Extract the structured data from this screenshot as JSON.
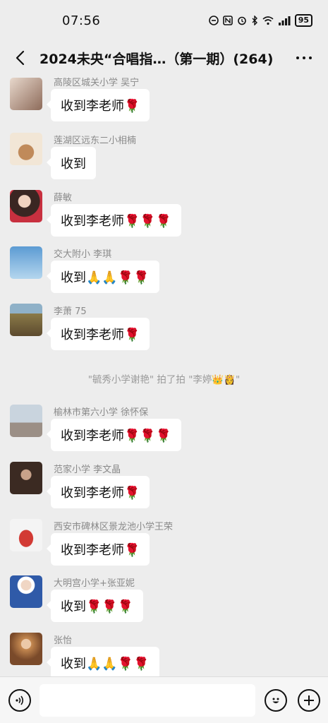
{
  "status_bar": {
    "time": "07:56",
    "battery": "95",
    "icons": [
      "nfc-icon",
      "mute-icon",
      "alarm-icon",
      "bluetooth-icon",
      "wifi-icon",
      "signal-icon",
      "battery-icon"
    ]
  },
  "header": {
    "title": "2024未央“合唱指…（第一期）(264)"
  },
  "messages": [
    {
      "sender": "高陵区城关小学  吴宁",
      "text": "收到李老师🌹",
      "avatar_color": "#c9b6a8"
    },
    {
      "sender": "莲湖区远东二小相楠",
      "text": "收到",
      "avatar_color": "#e9d9c3"
    },
    {
      "sender": "薛敏",
      "text": "收到李老师🌹🌹🌹",
      "avatar_color": "#b3475a"
    },
    {
      "sender": "交大附小  李琪",
      "text": "收到🙏🙏🌹🌹",
      "avatar_color": "#7fb2d9"
    },
    {
      "sender": "李萧 75",
      "text": "收到李老师🌹",
      "avatar_color": "#a99060"
    },
    {
      "sender": "榆林市第六小学  徐怀保",
      "text": "收到李老师🌹🌹🌹",
      "avatar_color": "#9aa7b4"
    },
    {
      "sender": "范家小学 李文晶",
      "text": "收到李老师🌹",
      "avatar_color": "#5a4036"
    },
    {
      "sender": "西安市碑林区景龙池小学王荣",
      "text": "收到李老师🌹",
      "avatar_color": "#d23a34"
    },
    {
      "sender": "大明宫小学+张亚妮",
      "text": "收到🌹🌹🌹",
      "avatar_color": "#2f5aa8"
    },
    {
      "sender": "张怡",
      "text": "收到🙏🙏🌹🌹",
      "avatar_color": "#c48850"
    }
  ],
  "system_note": "\"毓秀小学谢艳\" 拍了拍 \"李婷👑👸\"",
  "input_bar": {
    "placeholder": ""
  }
}
